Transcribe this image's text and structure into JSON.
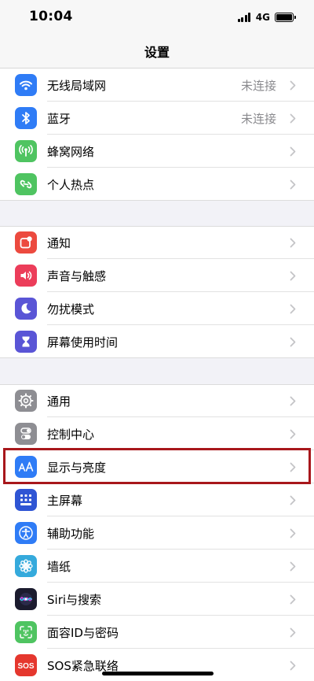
{
  "status_bar": {
    "time": "10:04",
    "network": "4G"
  },
  "nav": {
    "title": "设置"
  },
  "groups": [
    {
      "items": [
        {
          "label": "无线局域网",
          "value": "未连接",
          "icon": "wifi-icon",
          "color": "#2f7cf6"
        },
        {
          "label": "蓝牙",
          "value": "未连接",
          "icon": "bluetooth-icon",
          "color": "#2f7cf6"
        },
        {
          "label": "蜂窝网络",
          "icon": "cellular-icon",
          "color": "#4fc461"
        },
        {
          "label": "个人热点",
          "icon": "hotspot-icon",
          "color": "#4fc461"
        }
      ]
    },
    {
      "items": [
        {
          "label": "通知",
          "icon": "notification-icon",
          "color": "#ec4a3f"
        },
        {
          "label": "声音与触感",
          "icon": "sound-icon",
          "color": "#ec3d5a"
        },
        {
          "label": "勿扰模式",
          "icon": "moon-icon",
          "color": "#5a55d6"
        },
        {
          "label": "屏幕使用时间",
          "icon": "hourglass-icon",
          "color": "#5a55d6"
        }
      ]
    },
    {
      "items": [
        {
          "label": "通用",
          "icon": "gear-icon",
          "color": "#8e8e93"
        },
        {
          "label": "控制中心",
          "icon": "toggle-icon",
          "color": "#8e8e93"
        },
        {
          "label": "显示与亮度",
          "icon": "text-size-icon",
          "color": "#2f7cf6",
          "highlighted": true
        },
        {
          "label": "主屏幕",
          "icon": "home-grid-icon",
          "color": "#2f55d4"
        },
        {
          "label": "辅助功能",
          "icon": "accessibility-icon",
          "color": "#2f7cf6"
        },
        {
          "label": "墙纸",
          "icon": "flower-icon",
          "color": "#35aadc"
        },
        {
          "label": "Siri与搜索",
          "icon": "siri-icon",
          "color": "#1b1b2e"
        },
        {
          "label": "面容ID与密码",
          "icon": "face-id-icon",
          "color": "#4fc461"
        },
        {
          "label": "SOS紧急联络",
          "icon": "sos-icon",
          "color": "#e5372e"
        }
      ]
    }
  ],
  "highlight_color": "#a8171b"
}
